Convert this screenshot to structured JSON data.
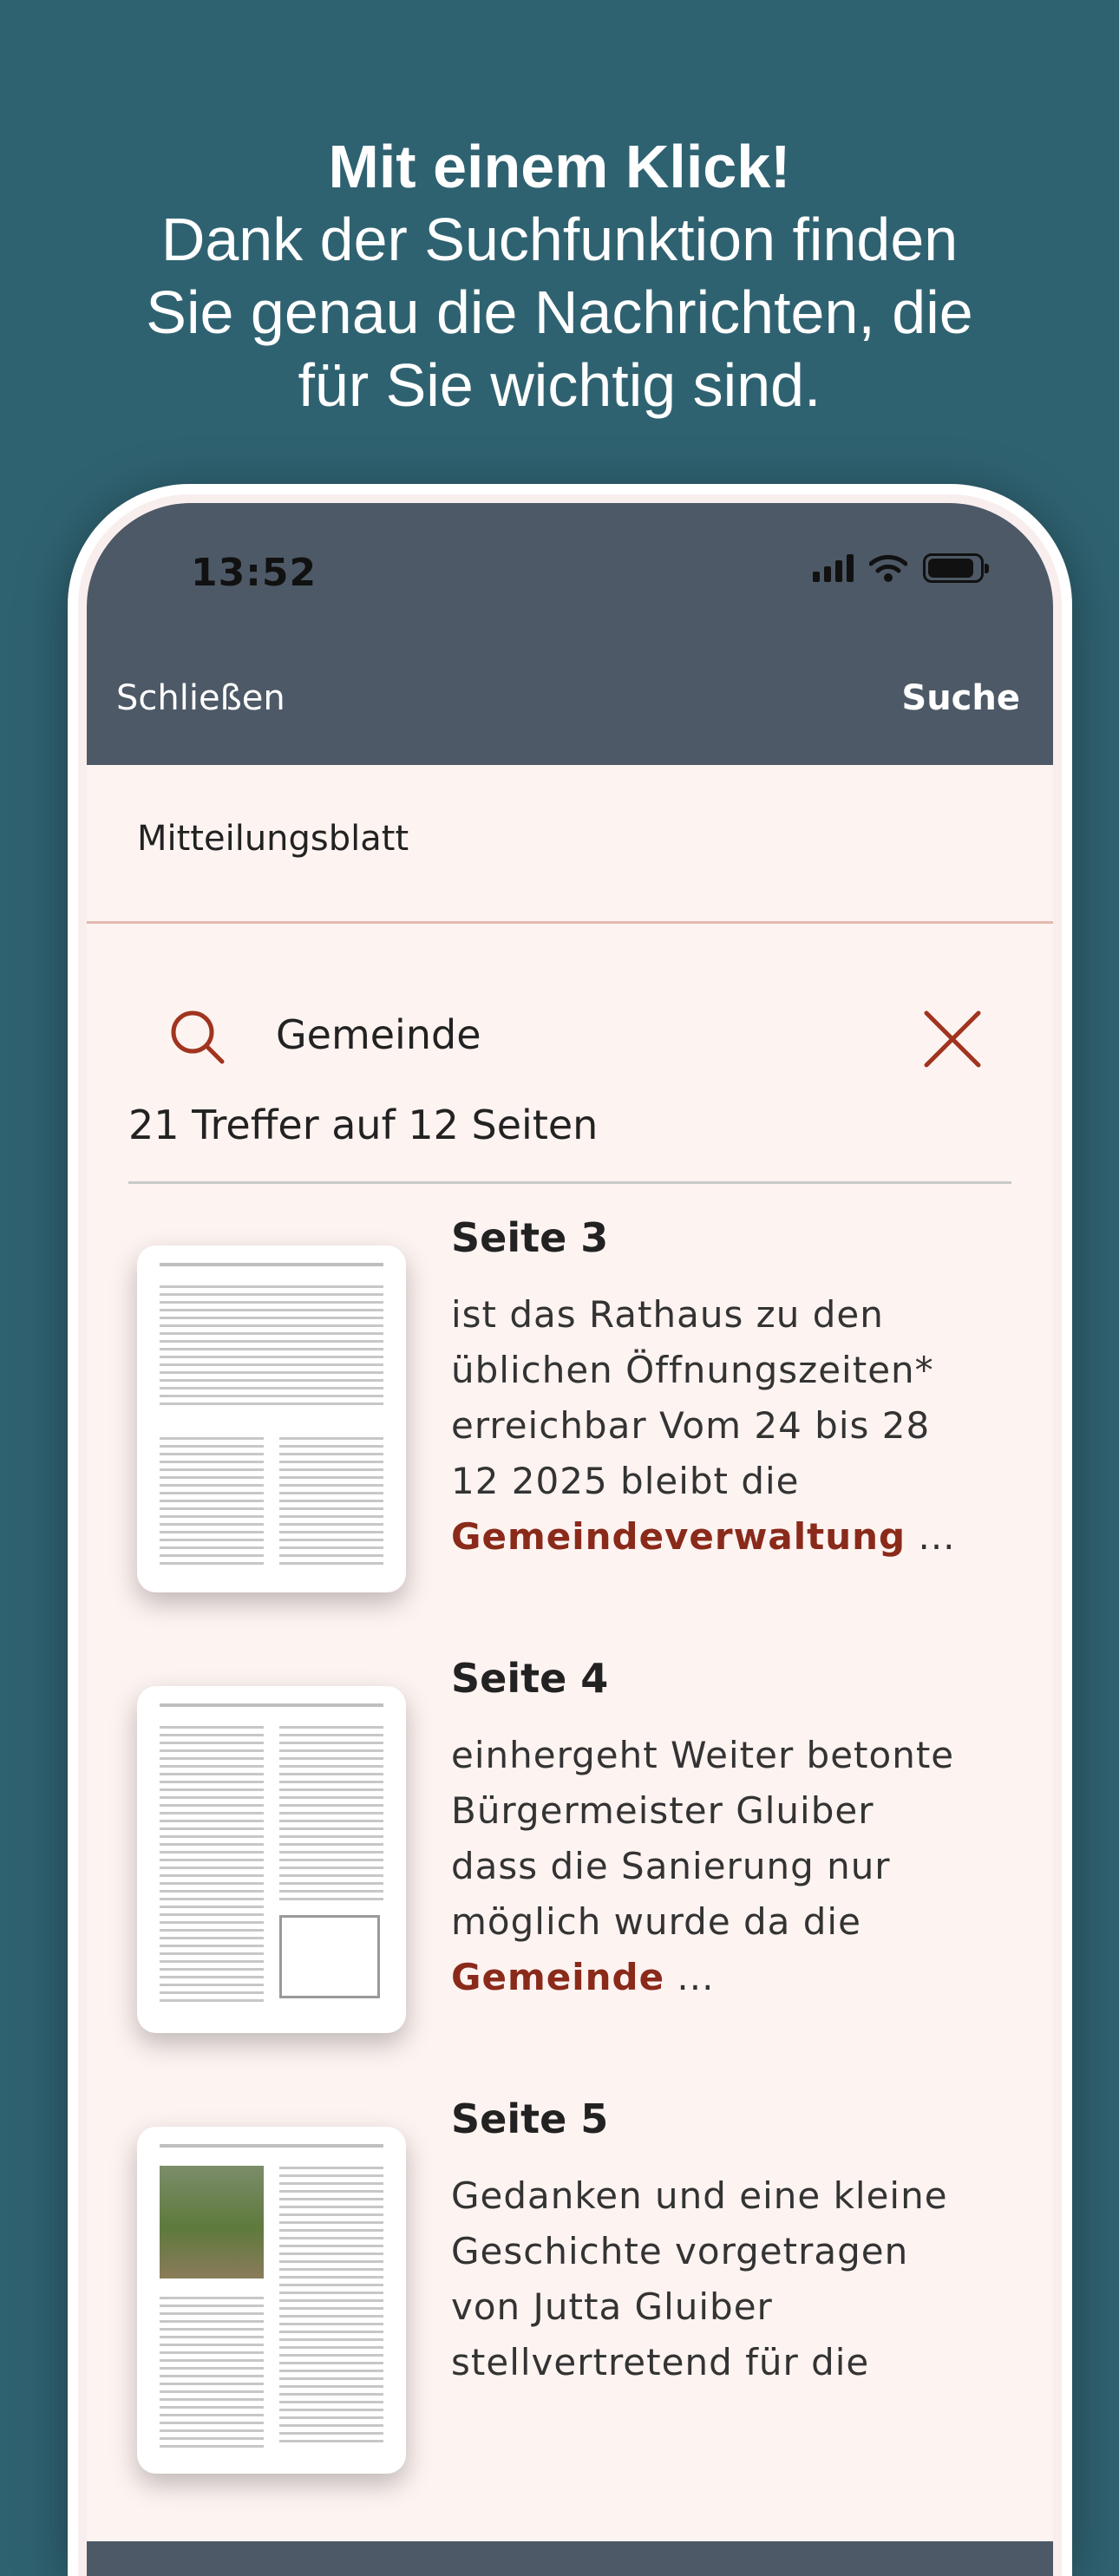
{
  "headline": {
    "line1": "Mit einem Klick!",
    "line2": "Dank der Suchfunktion finden",
    "line3": "Sie genau die Nachrichten, die",
    "line4": "für Sie wichtig sind."
  },
  "status_bar": {
    "time": "13:52"
  },
  "nav": {
    "close_label": "Schließen",
    "search_label": "Suche"
  },
  "section_label": "Mitteilungsblatt",
  "search": {
    "value": "Gemeinde"
  },
  "hits_label": "21 Treffer auf 12 Seiten",
  "results": [
    {
      "title": "Seite 3",
      "text_before": "ist das Rathaus zu den üblichen Öffnungszeiten* erreichbar Vom 24 bis 28 12 2025 bleibt die ",
      "highlight": "Gemeindeverwaltung",
      "text_after": " ..."
    },
    {
      "title": "Seite 4",
      "text_before": "einhergeht Weiter betonte Bürgermeister Gluiber dass die Sanierung nur möglich wurde da die ",
      "highlight": "Gemeinde",
      "text_after": " ..."
    },
    {
      "title": "Seite 5",
      "text_before": "Gedanken und eine kleine Geschichte vorgetragen von Jutta Gluiber stellvertretend für die",
      "highlight": "",
      "text_after": ""
    }
  ],
  "colors": {
    "background": "#2f6271",
    "topbar": "#4d5966",
    "screen": "#fdf3f1",
    "highlight": "#8a2a1a"
  }
}
